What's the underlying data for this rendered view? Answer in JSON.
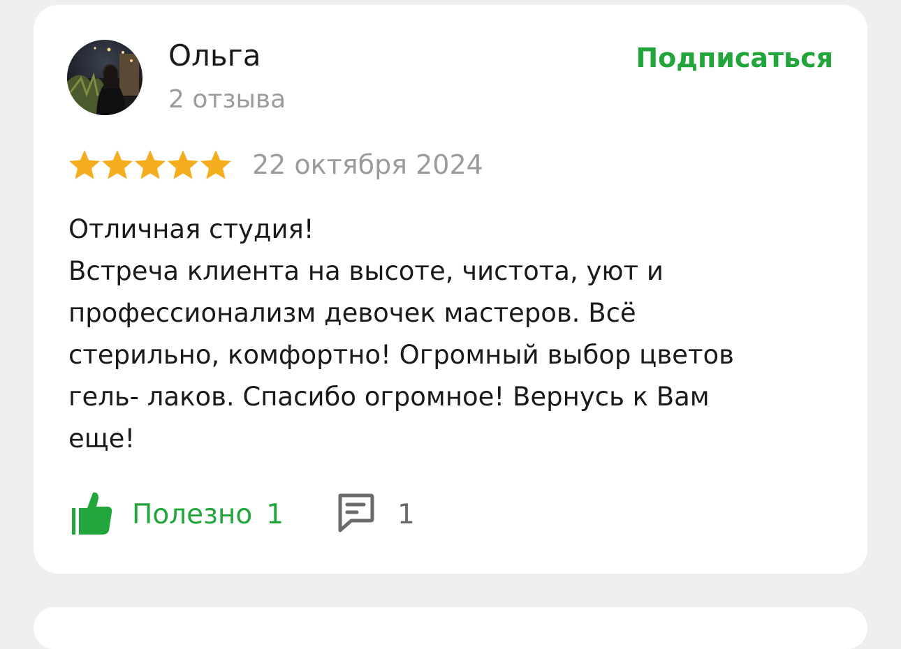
{
  "review": {
    "author": {
      "name": "Ольга",
      "reviews_count": "2 отзыва",
      "avatar": "user-photo"
    },
    "subscribe_label": "Подписаться",
    "rating": 5,
    "rating_max": 5,
    "date": "22 октября 2024",
    "text_lines": [
      "Отличная студия!",
      "Встреча клиента на высоте, чистота, уют и",
      "профессионализм девочек мастеров. Всё",
      "стерильно, комфортно! Огромный выбор цветов",
      "гель- лаков. Спасибо огромное! Вернусь к Вам",
      "еще!"
    ],
    "helpful": {
      "icon": "thumbs-up-icon",
      "label": "Полезно",
      "count": "1"
    },
    "comments": {
      "icon": "comment-icon",
      "count": "1"
    }
  },
  "colors": {
    "accent_green": "#22a53a",
    "star_gold": "#f4ad1d",
    "muted_text": "#9b9b9b",
    "page_background": "#efefef"
  }
}
